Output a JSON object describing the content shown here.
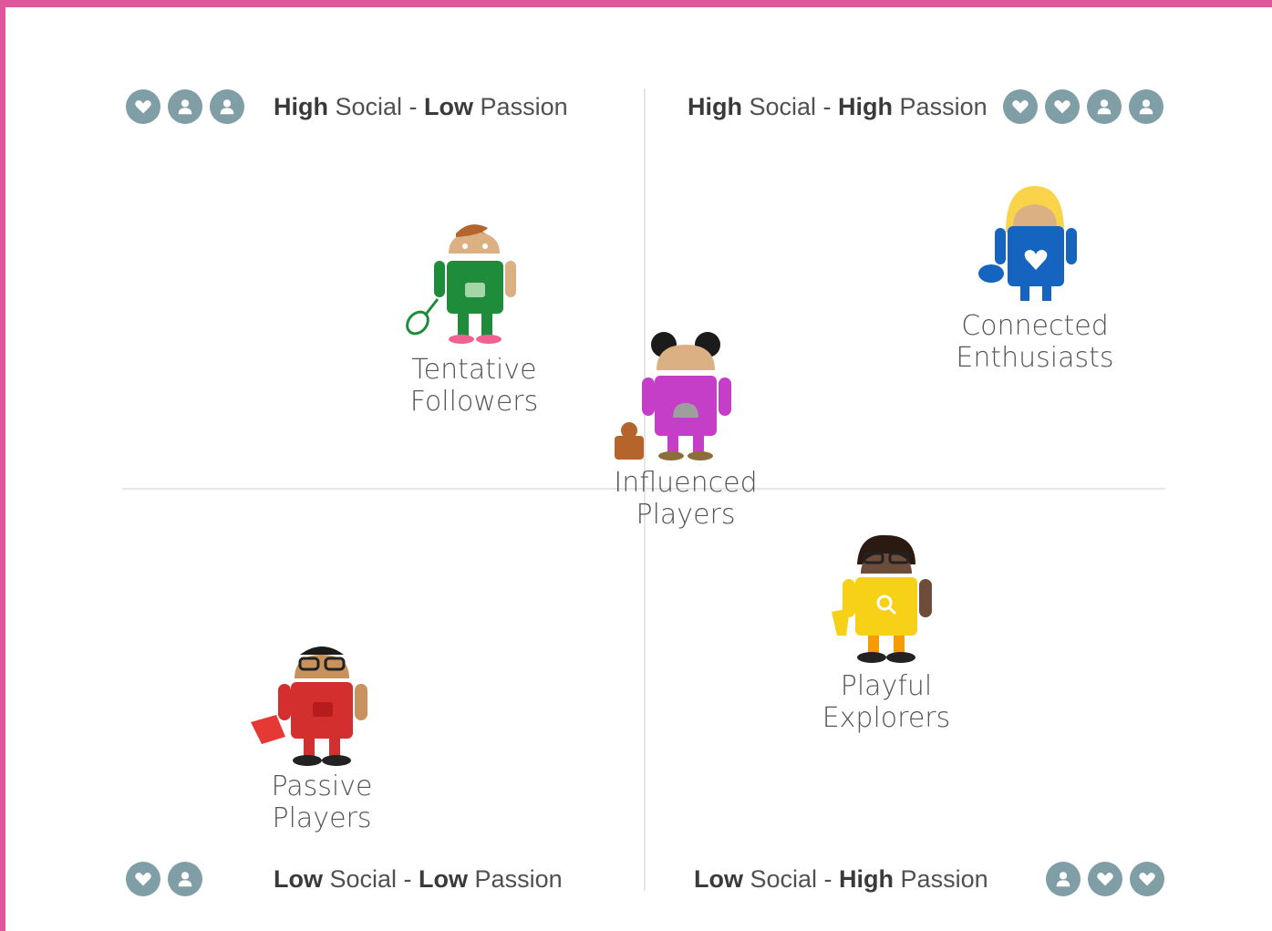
{
  "colors": {
    "frame": "#e0559b",
    "badge": "#7f9ea6",
    "axis": "#e6e6e6"
  },
  "quadrants": {
    "top_left": {
      "bold1": "High",
      "text1": " Social - ",
      "bold2": "Low",
      "text2": " Passion",
      "icons": [
        "heart-icon",
        "person-icon",
        "person-icon"
      ]
    },
    "top_right": {
      "bold1": "High",
      "text1": " Social - ",
      "bold2": "High",
      "text2": " Passion",
      "icons": [
        "heart-icon",
        "heart-icon",
        "person-icon",
        "person-icon"
      ]
    },
    "bottom_left": {
      "bold1": "Low",
      "text1": " Social - ",
      "bold2": "Low",
      "text2": " Passion",
      "icons": [
        "heart-icon",
        "person-icon"
      ]
    },
    "bottom_right": {
      "bold1": "Low",
      "text1": " Social - ",
      "bold2": "High",
      "text2": " Passion",
      "icons": [
        "person-icon",
        "heart-icon",
        "heart-icon"
      ]
    }
  },
  "personas": {
    "tentative": {
      "line1": "Tentative",
      "line2": "Followers",
      "color": "#1e8c3a"
    },
    "connected": {
      "line1": "Connected",
      "line2": "Enthusiasts",
      "color": "#1565c0"
    },
    "influenced": {
      "line1": "Influenced",
      "line2": "Players",
      "color": "#c43ec7"
    },
    "playful": {
      "line1": "Playful",
      "line2": "Explorers",
      "color": "#f7d117"
    },
    "passive": {
      "line1": "Passive",
      "line2": "Players",
      "color": "#d32f2f"
    }
  }
}
